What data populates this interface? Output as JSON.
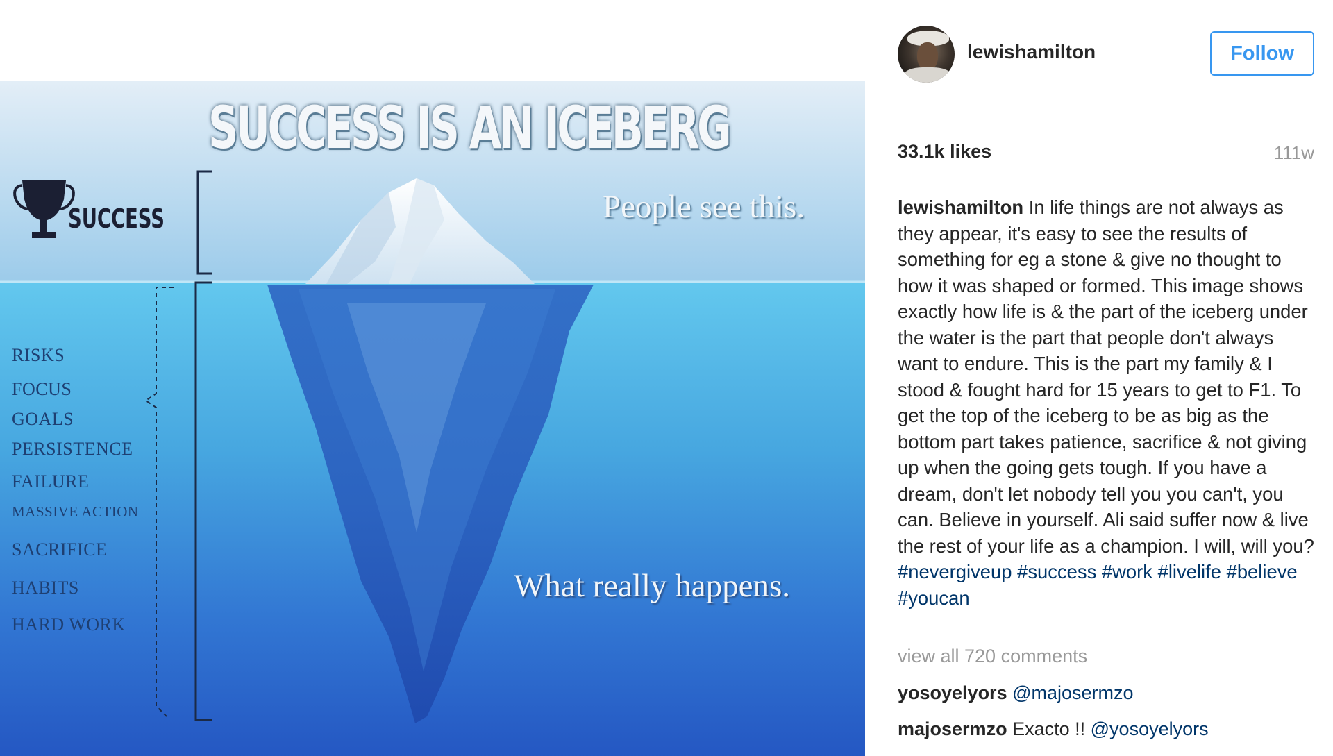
{
  "post_image": {
    "title": "SUCCESS IS AN ICEBERG",
    "success_label": "SUCCESS",
    "people_text": "People see this.",
    "what_text": "What really happens.",
    "traits": [
      "RISKS",
      "FOCUS",
      "GOALS",
      "PERSISTENCE",
      "FAILURE",
      "MASSIVE ACTION",
      "SACRIFICE",
      "HABITS",
      "HARD WORK"
    ]
  },
  "header": {
    "username": "lewishamilton",
    "follow_label": "Follow",
    "avatar_icon": "profile-photo-avatar"
  },
  "stats": {
    "likes": "33.1k likes",
    "age": "111w"
  },
  "caption": {
    "username": "lewishamilton",
    "text": "In life things are not always as they appear, it's easy to see the results of something for eg a stone & give no thought to how it was shaped or formed. This image shows exactly how life is & the part of the iceberg under the water is the part that people don't always want to endure. This is the part my family & I stood & fought hard for 15 years to get to F1. To get the top of the iceberg to be as big as the bottom part takes patience, sacrifice & not giving up when the going gets tough. If you have a dream, don't let nobody tell you you can't, you can. Believe in yourself. Ali said suffer now & live the rest of your life as a champion. I will, will you?",
    "hashtags": [
      "#nevergiveup",
      "#success",
      "#work",
      "#livelife",
      "#believe",
      "#youcan"
    ]
  },
  "comments": {
    "view_all": "view all 720 comments",
    "items": [
      {
        "user": "yosoyelyors",
        "text": "",
        "mention": "@majosermzo"
      },
      {
        "user": "majosermzo",
        "text": "Exacto !!",
        "mention": "@yosoyelyors"
      }
    ]
  },
  "colors": {
    "link_blue": "#3897f0",
    "hashtag": "#003569",
    "muted": "#999999",
    "text": "#262626"
  }
}
